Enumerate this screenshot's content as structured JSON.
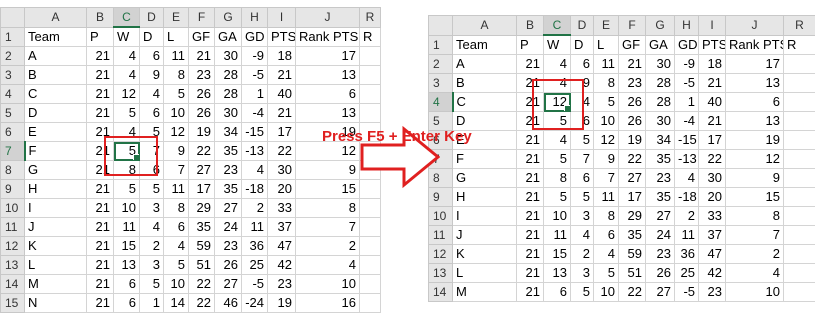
{
  "caption": "Press F5 + Enter Key",
  "columns": [
    "A",
    "B",
    "C",
    "D",
    "E",
    "F",
    "G",
    "H",
    "I",
    "J",
    "R"
  ],
  "header_row": [
    "Team",
    "P",
    "W",
    "D",
    "L",
    "GF",
    "GA",
    "GD",
    "PTS",
    "Rank PTS",
    "R"
  ],
  "rows": [
    [
      "A",
      "21",
      "4",
      "6",
      "11",
      "21",
      "30",
      "-9",
      "18",
      "17"
    ],
    [
      "B",
      "21",
      "4",
      "9",
      "8",
      "23",
      "28",
      "-5",
      "21",
      "13"
    ],
    [
      "C",
      "21",
      "12",
      "4",
      "5",
      "26",
      "28",
      "1",
      "40",
      "6"
    ],
    [
      "D",
      "21",
      "5",
      "6",
      "10",
      "26",
      "30",
      "-4",
      "21",
      "13"
    ],
    [
      "E",
      "21",
      "4",
      "5",
      "12",
      "19",
      "34",
      "-15",
      "17",
      "19"
    ],
    [
      "F",
      "21",
      "5",
      "7",
      "9",
      "22",
      "35",
      "-13",
      "22",
      "12"
    ],
    [
      "G",
      "21",
      "8",
      "6",
      "7",
      "27",
      "23",
      "4",
      "30",
      "9"
    ],
    [
      "H",
      "21",
      "5",
      "5",
      "11",
      "17",
      "35",
      "-18",
      "20",
      "15"
    ],
    [
      "I",
      "21",
      "10",
      "3",
      "8",
      "29",
      "27",
      "2",
      "33",
      "8"
    ],
    [
      "J",
      "21",
      "11",
      "4",
      "6",
      "35",
      "24",
      "11",
      "37",
      "7"
    ],
    [
      "K",
      "21",
      "15",
      "2",
      "4",
      "59",
      "23",
      "36",
      "47",
      "2"
    ],
    [
      "L",
      "21",
      "13",
      "3",
      "5",
      "51",
      "26",
      "25",
      "42",
      "4"
    ],
    [
      "M",
      "21",
      "6",
      "5",
      "10",
      "22",
      "27",
      "-5",
      "23",
      "10"
    ],
    [
      "N",
      "21",
      "6",
      "1",
      "14",
      "22",
      "46",
      "-24",
      "19",
      "16"
    ]
  ],
  "left_sheet": {
    "visible_rows": 15,
    "active_row": 7,
    "active_col": "C"
  },
  "right_sheet": {
    "visible_rows": 14,
    "active_row": 4,
    "active_col": "C"
  },
  "colors": {
    "excel_green": "#217346",
    "highlight_red": "#e02020"
  }
}
